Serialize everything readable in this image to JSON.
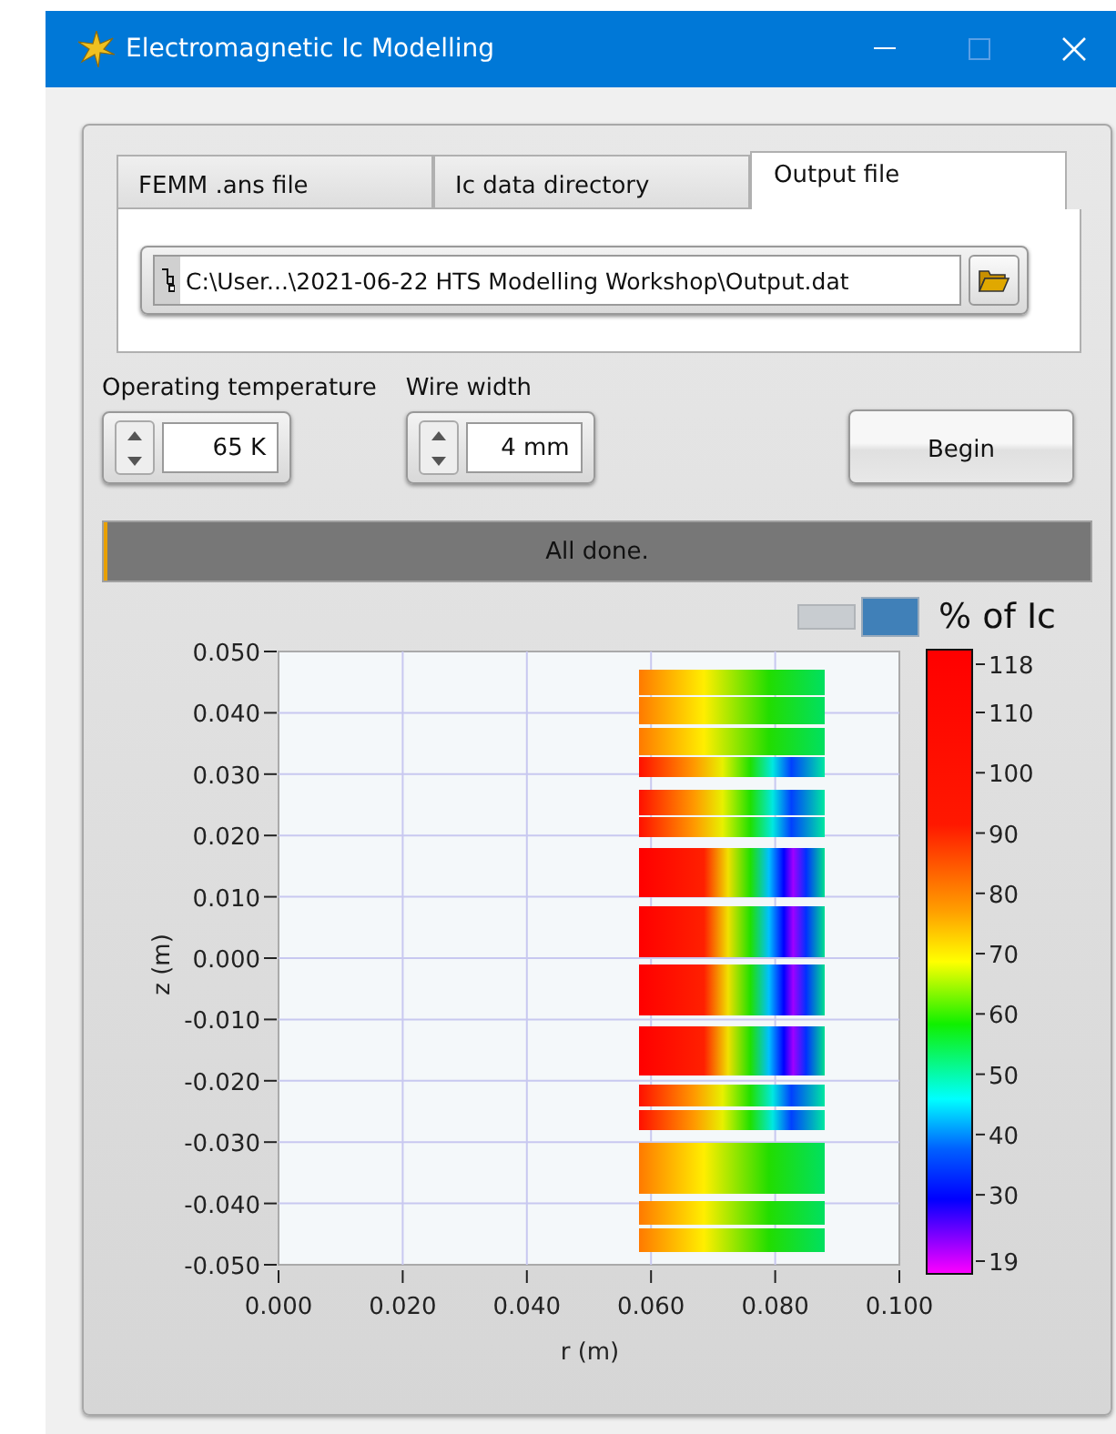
{
  "window": {
    "title": "Electromagnetic Ic Modelling"
  },
  "tabs": [
    {
      "label": "FEMM .ans file",
      "selected": false
    },
    {
      "label": "Ic data directory",
      "selected": false
    },
    {
      "label": "Output file",
      "selected": true
    }
  ],
  "path_field": {
    "value": "C:\\User...\\2021-06-22 HTS Modelling Workshop\\Output.dat"
  },
  "controls": [
    {
      "label": "Operating temperature",
      "value": "65 K"
    },
    {
      "label": "Wire width",
      "value": "4 mm"
    }
  ],
  "begin_button": {
    "label": "Begin"
  },
  "status": {
    "text": "All done.",
    "level": 0.004
  },
  "plot": {
    "legend_label": "% of Ic",
    "ylabel": "z (m)",
    "xlabel": "r (m)",
    "yticks": [
      "0.050",
      "0.040",
      "0.030",
      "0.020",
      "0.010",
      "0.000",
      "-0.010",
      "-0.020",
      "-0.030",
      "-0.040",
      "-0.050"
    ],
    "xticks": [
      "0.000",
      "0.020",
      "0.040",
      "0.060",
      "0.080",
      "0.100"
    ],
    "colorbar_ticks": [
      "118",
      "110",
      "100",
      "90",
      "80",
      "70",
      "60",
      "50",
      "40",
      "30",
      "19"
    ]
  }
}
